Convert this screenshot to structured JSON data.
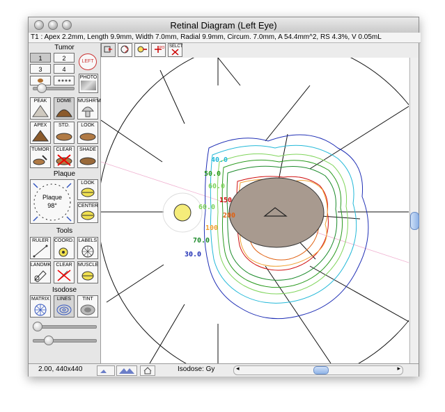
{
  "window": {
    "title": "Retinal Diagram (Left Eye)"
  },
  "info_line": "T1 : Apex 2.2mm, Length 9.9mm, Width 7.0mm, Radial 9.9mm, Circum. 7.0mm, A 54.4mm^2, RS 4.3%, V 0.05mL",
  "toolbar": {
    "btn5_label": "SELCT"
  },
  "tumor": {
    "section_label": "Tumor",
    "num_buttons": [
      "1",
      "2",
      "3",
      "4"
    ],
    "left_label": "LEFT",
    "photo_label": "PHOTO",
    "shape_buttons": [
      "PEAK",
      "DOME",
      "MUSHR'M",
      "APEX",
      "STD.",
      "LOOK",
      "TUMOR",
      "CLEAR",
      "SHADE"
    ]
  },
  "plaque": {
    "section_label": "Plaque",
    "dial_label": "Plaque",
    "dial_value": "98°",
    "look_label": "LOOK",
    "center_label": "CENTER"
  },
  "tools": {
    "section_label": "Tools",
    "buttons": [
      "RULER",
      "COORD.",
      "LABELS",
      "LANDMK",
      "CLEAR",
      "MUSCLE"
    ]
  },
  "isodose": {
    "section_label": "Isodose",
    "buttons": [
      "MATRIX",
      "LINES",
      "TINT"
    ],
    "labels": [
      "40.0",
      "50.0",
      "60.0",
      "150",
      "200",
      "60.0",
      "100",
      "70.0",
      "30.0"
    ],
    "colors": {
      "c30": "#1f2fb5",
      "c40": "#22b8d8",
      "c50": "#2a9a1e",
      "c60": "#7fd45a",
      "c70": "#1b8a2a",
      "c100": "#f0a030",
      "c150": "#d01010",
      "c200": "#e06010"
    }
  },
  "status": {
    "zoom": "2.00, 440x440",
    "isodose_unit": "Isodose: Gy"
  }
}
